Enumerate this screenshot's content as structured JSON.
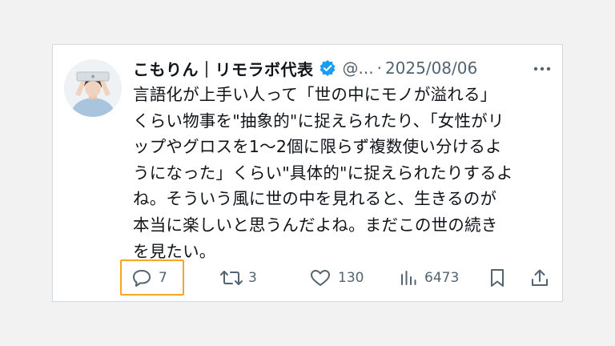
{
  "tweet": {
    "author_name": "こもりん｜リモラボ代表",
    "handle": "@...",
    "date_separator": "·",
    "date": "2025/08/06",
    "text": "言語化が上手い人って「世の中にモノが溢れる」\nくらい物事を\"抽象的\"に捉えられたり、「女性がリ\nップやグロスを1〜2個に限らず複数使い分けるよ\nうになった」くらい\"具体的\"に捉えられたりするよ\nね。そういう風に世の中を見れると、生きるのが\n本当に楽しいと思うんだよね。まだこの世の続き\nを見たい。",
    "avatar_icon": "person-avatar",
    "verified_icon": "verified-badge-icon",
    "more_icon": "more-dots-icon"
  },
  "actions": {
    "reply": {
      "icon": "reply-icon",
      "count": "7"
    },
    "retweet": {
      "icon": "retweet-icon",
      "count": "3"
    },
    "like": {
      "icon": "heart-icon",
      "count": "130"
    },
    "views": {
      "icon": "views-icon",
      "count": "6473"
    },
    "bookmark": {
      "icon": "bookmark-icon"
    },
    "share": {
      "icon": "share-icon"
    }
  },
  "colors": {
    "text_primary": "#0f1419",
    "text_secondary": "#536471",
    "verified": "#1d9bf0",
    "highlight": "#f5a623"
  }
}
